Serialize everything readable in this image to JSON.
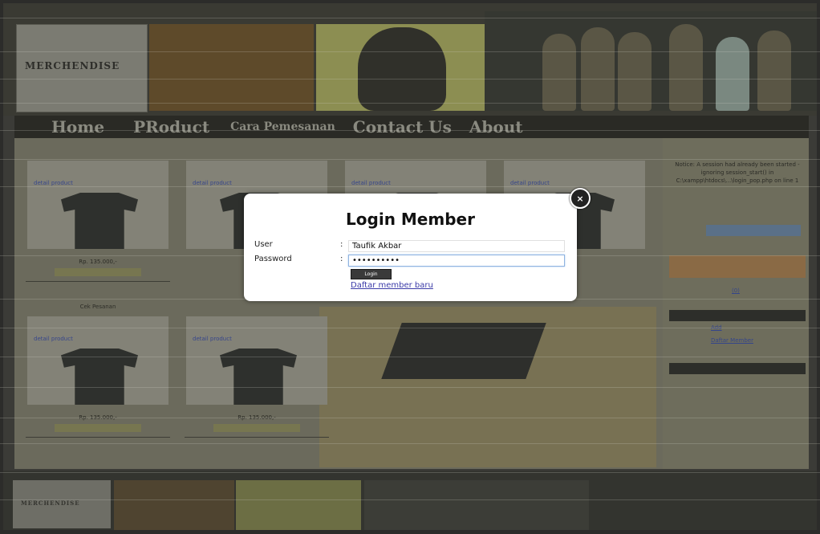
{
  "header": {
    "logo_text": "MERCHENDISE"
  },
  "nav": {
    "items": [
      {
        "label": "Home",
        "small": false
      },
      {
        "label": "PRoduct",
        "small": false
      },
      {
        "label": "Cara Pemesanan",
        "small": true
      },
      {
        "label": "Contact Us",
        "small": false
      },
      {
        "label": "About",
        "small": false
      }
    ]
  },
  "products_row1": [
    {
      "link": "detail product"
    },
    {
      "link": "detail product"
    },
    {
      "link": "detail product"
    },
    {
      "link": "detail product"
    }
  ],
  "products_row2": [
    {
      "name": "Cek Pesanan",
      "link": "detail product",
      "price": "Rp. 135.000,-"
    },
    {
      "name": "",
      "link": "detail product",
      "price": "Rp. 135.000,-"
    }
  ],
  "row1_prices": [
    "Rp. 135.000,-"
  ],
  "sidebar": {
    "notice": "Notice: A session had already been started - ignoring session_start() in C:\\xampp\\htdocs\\...\\login_pop.php on line 1",
    "count": "(0)",
    "link1": "Add",
    "link2": "Daftar Member"
  },
  "modal": {
    "title": "Login Member",
    "close_symbol": "×",
    "user_label": "User",
    "user_value": "Taufik Akbar",
    "password_label": "Password",
    "password_value": "••••••••••",
    "colon": ":",
    "login_button": "Login",
    "register_link": "Daftar member baru"
  },
  "colors": {
    "modal_bg": "#ffffff",
    "overlay": "#3b3b37",
    "link": "#3b3ba8"
  }
}
